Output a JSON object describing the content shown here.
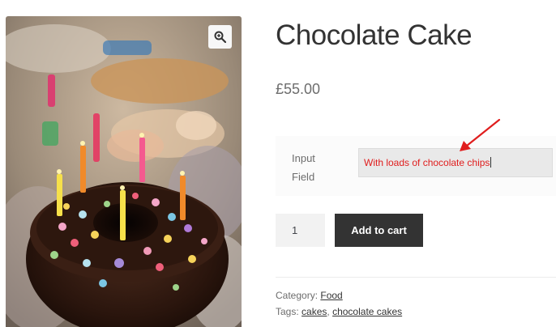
{
  "product": {
    "title": "Chocolate Cake",
    "price": "£55.00",
    "image_icon": "birthday-cake-photo"
  },
  "addon": {
    "label_line1": "Input",
    "label_line2": "Field",
    "value": "With loads of chocolate chips"
  },
  "cart": {
    "quantity": "1",
    "add_label": "Add to cart"
  },
  "meta": {
    "category_prefix": "Category:",
    "category": "Food",
    "tags_prefix": "Tags:",
    "tag1": "cakes",
    "tag_separator": ",",
    "tag2": "chocolate cakes"
  },
  "colors": {
    "annotation_arrow": "#e01d1d",
    "button": "#333333"
  }
}
